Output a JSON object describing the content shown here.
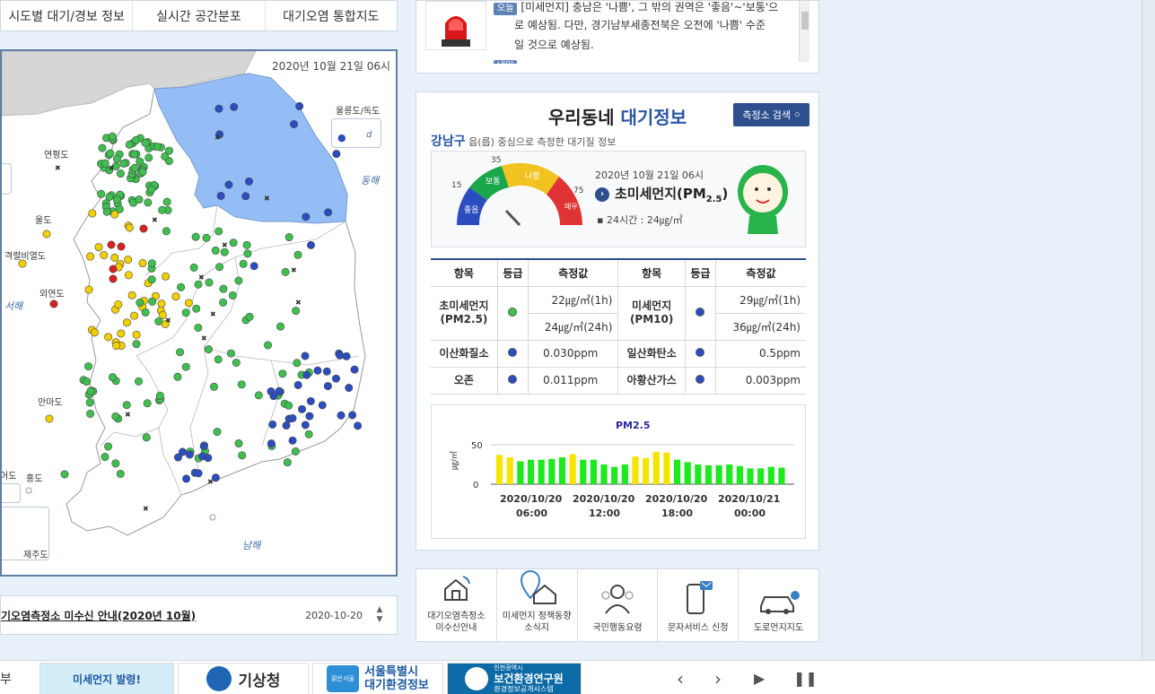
{
  "tabs": [
    "시도별 대기/경보 정보",
    "실시간 공간분포",
    "대기오염 통합지도"
  ],
  "map": {
    "date": "2020년 10월 21일 06시",
    "labels": {
      "ulleung": "울릉도/독도",
      "yeonpyeong": "연평도",
      "uldo": "울도",
      "gyeokryeol": "격렬비열도",
      "oeyeon": "외연도",
      "anma": "안마도",
      "eocheong": "어도",
      "hongdo": "홍도",
      "jeju": "제주도"
    },
    "seas": {
      "west": "서해",
      "east": "동해",
      "south": "남해"
    },
    "dokdo_mark": "d"
  },
  "notice": {
    "title": "기오염측정소 미수신 안내(2020년 10월)",
    "date": "2020-10-20"
  },
  "alert": {
    "rows": [
      {
        "badge": "오늘",
        "text": "[미세먼지] 충남은 '나쁨', 그 밖의 권역은 '좋음'~'보통'으"
      },
      {
        "badge": "",
        "text": "로 예상됨. 다만, 경기남부세종전북은 오전에 '나쁨' 수준"
      },
      {
        "badge": "",
        "text": "일 것으로 예상됨."
      },
      {
        "badge": "내일",
        "text": ""
      }
    ]
  },
  "info": {
    "title_pre": "우리동네",
    "title_blue": "대기정보",
    "search_label": "측정소 검색",
    "region": "강남구",
    "region_suffix": " 읍(릅) 중심으로 측정한 대기질 정보",
    "gauge": {
      "date": "2020년 10월 21일 06시",
      "item": "초미세먼지(PM",
      "item_sub": "2.5",
      "item_close": ")",
      "pm24": "▪ 24시간 : 24㎍/㎥",
      "ticks": [
        "15",
        "35",
        "75"
      ],
      "bands": [
        "좋음",
        "보통",
        "나쁨",
        "매우 나쁨"
      ]
    },
    "table": {
      "headers": [
        "항목",
        "등급",
        "측정값",
        "항목",
        "등급",
        "측정값"
      ],
      "pm25_name": "초미세먼지",
      "pm25_sub": "(PM2.5)",
      "pm10_name": "미세먼지",
      "pm10_sub": "(PM10)",
      "pm25_1h": "22㎍/㎥(1h)",
      "pm25_24h": "24㎍/㎥(24h)",
      "pm10_1h": "29㎍/㎥(1h)",
      "pm10_24h": "36㎍/㎥(24h)",
      "no2_name": "이산화질소",
      "no2_val": "0.030ppm",
      "co_name": "일산화탄소",
      "co_val": "0.5ppm",
      "o3_name": "오존",
      "o3_val": "0.011ppm",
      "so2_name": "아황산가스",
      "so2_val": "0.003ppm"
    }
  },
  "chart_data": {
    "type": "bar",
    "title": "PM2.5",
    "ylabel": "㎍/㎥",
    "ylim": [
      0,
      50
    ],
    "yticks": [
      0,
      50
    ],
    "xtick_labels": [
      [
        "2020/10/20",
        "06:00"
      ],
      [
        "2020/10/20",
        "12:00"
      ],
      [
        "2020/10/20",
        "18:00"
      ],
      [
        "2020/10/21",
        "00:00"
      ]
    ],
    "values": [
      37,
      34,
      29,
      31,
      31,
      32,
      34,
      38,
      31,
      31,
      25,
      22,
      25,
      35,
      33,
      41,
      40,
      31,
      28,
      25,
      24,
      24,
      25,
      23,
      20,
      20,
      22,
      21
    ],
    "colors": [
      "#f5e400",
      "#f5e400",
      "#1ee81e",
      "#1ee81e",
      "#1ee81e",
      "#1ee81e",
      "#1ee81e",
      "#f5e400",
      "#1ee81e",
      "#1ee81e",
      "#1ee81e",
      "#1ee81e",
      "#1ee81e",
      "#f5e400",
      "#f5e400",
      "#f5e400",
      "#f5e400",
      "#1ee81e",
      "#1ee81e",
      "#1ee81e",
      "#1ee81e",
      "#1ee81e",
      "#1ee81e",
      "#1ee81e",
      "#1ee81e",
      "#1ee81e",
      "#1ee81e",
      "#1ee81e"
    ]
  },
  "menu": [
    {
      "label": "대기오염측정소\n미수신안내"
    },
    {
      "label": "미세먼지 정책동향\n소식지"
    },
    {
      "label": "국민행동요령"
    },
    {
      "label": "문자서비스 신청"
    },
    {
      "label": "도로먼지지도"
    }
  ],
  "footer": {
    "left": "부",
    "banner1": "미세먼지 발령!",
    "banner2": "기상청",
    "banner3_top": "서울특별시",
    "banner3_bot": "대기환경정보",
    "banner3_small": "맑은서울",
    "banner4_top": "인천광역시",
    "banner4_mid": "보건환경연구원",
    "banner4_bot": "환경정보공개시스템"
  },
  "colors": {
    "good": "#2c4dbf",
    "normal": "#3fbf4f",
    "bad": "#f0d000",
    "very_bad": "#d92020",
    "accent": "#2d4f8d"
  }
}
